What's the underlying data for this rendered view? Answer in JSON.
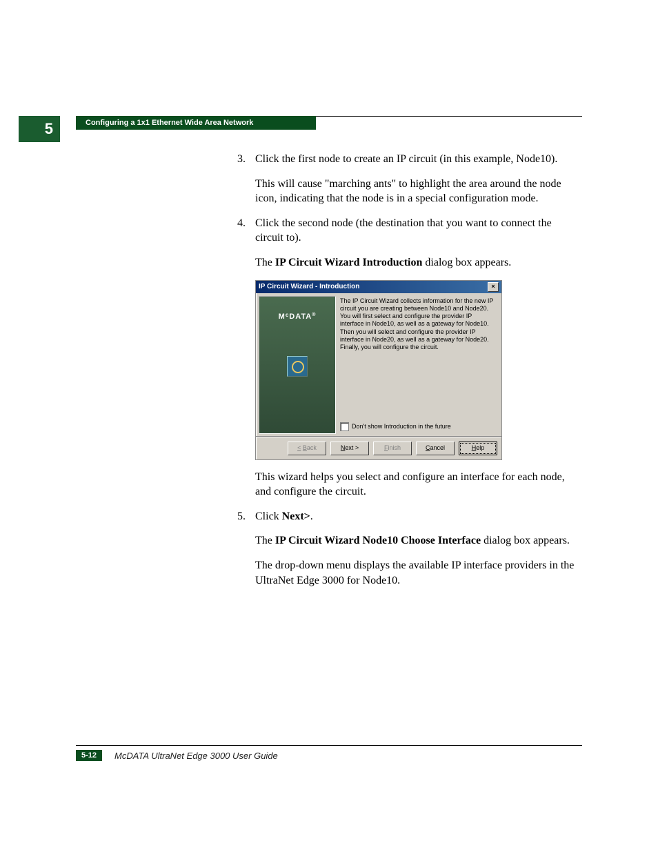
{
  "chapter_number": "5",
  "header_title": "Configuring a 1x1 Ethernet Wide Area Network",
  "steps": {
    "s3": {
      "num": "3.",
      "text": "Click the first node to create an IP circuit (in this example, Node10).",
      "para": "This will cause \"marching ants\" to highlight the area around the node icon, indicating that the node is in a special configuration mode."
    },
    "s4": {
      "num": "4.",
      "text": "Click the second node (the destination that you want to connect the circuit to).",
      "para_pre": "The ",
      "para_bold": "IP Circuit Wizard Introduction",
      "para_post": " dialog box appears."
    },
    "after_dialog": "This wizard helps you select and configure an interface for each node, and configure the circuit.",
    "s5": {
      "num": "5.",
      "pre": "Click ",
      "bold": "Next>",
      "post": ".",
      "p2_pre": "The ",
      "p2_bold": "IP Circuit Wizard Node10 Choose Interface",
      "p2_post": " dialog box appears.",
      "p3": "The drop-down menu displays the available IP interface providers in the UltraNet Edge 3000 for Node10."
    }
  },
  "dialog": {
    "title": "IP Circuit Wizard - Introduction",
    "brand": "McDATA",
    "description": "The IP Circuit Wizard collects information for the new IP circuit you are creating between Node10 and Node20. You will first select and configure the provider IP interface in Node10, as well as a gateway for Node10. Then you will select and configure the provider IP interface in Node20, as well as a gateway for Node20. Finally, you will configure the circuit.",
    "checkbox_label": "Don't show Introduction in the future",
    "buttons": {
      "back": "< Back",
      "next": "Next >",
      "finish": "Finish",
      "cancel": "Cancel",
      "help": "Help"
    }
  },
  "footer": {
    "page": "5-12",
    "title": "McDATA UltraNet Edge 3000 User Guide"
  }
}
